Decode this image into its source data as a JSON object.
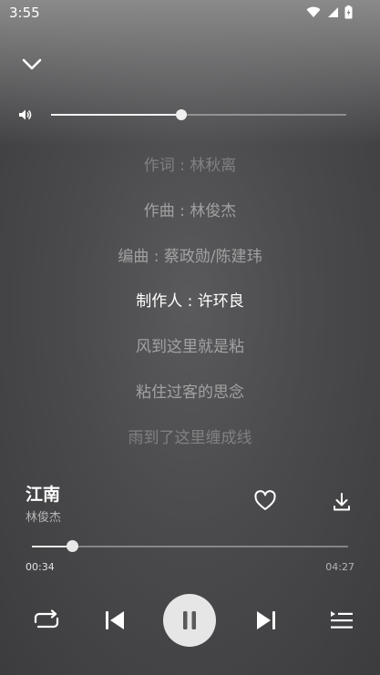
{
  "status_bar": {
    "time": "3:55",
    "icons": [
      "wifi-icon",
      "signal-icon",
      "battery-icon"
    ]
  },
  "header": {
    "collapse_icon": "chevron-down-icon"
  },
  "volume": {
    "icon": "speaker-icon",
    "level_percent": 44
  },
  "lyrics": [
    {
      "text": "作词 : 林秋离",
      "state": "dim"
    },
    {
      "text": "作曲 : 林俊杰",
      "state": "normal"
    },
    {
      "text": "编曲 : 蔡政勋/陈建玮",
      "state": "normal"
    },
    {
      "text": "制作人 : 许环良",
      "state": "active"
    },
    {
      "text": "风到这里就是粘",
      "state": "normal"
    },
    {
      "text": "粘住过客的思念",
      "state": "normal"
    },
    {
      "text": "雨到了这里缠成线",
      "state": "dim"
    }
  ],
  "song": {
    "title": "江南",
    "artist": "林俊杰"
  },
  "actions": {
    "favorite_icon": "heart-icon",
    "download_icon": "download-icon"
  },
  "progress": {
    "current": "00:34",
    "duration": "04:27",
    "fraction": 0.128
  },
  "controls": {
    "repeat_icon": "repeat-icon",
    "previous_icon": "skip-previous-icon",
    "play_pause_icon": "pause-icon",
    "next_icon": "skip-next-icon",
    "playlist_icon": "playlist-icon"
  },
  "colors": {
    "accent": "#ffffff",
    "background": "#4a4a4c",
    "play_button": "#e6e6e6"
  }
}
